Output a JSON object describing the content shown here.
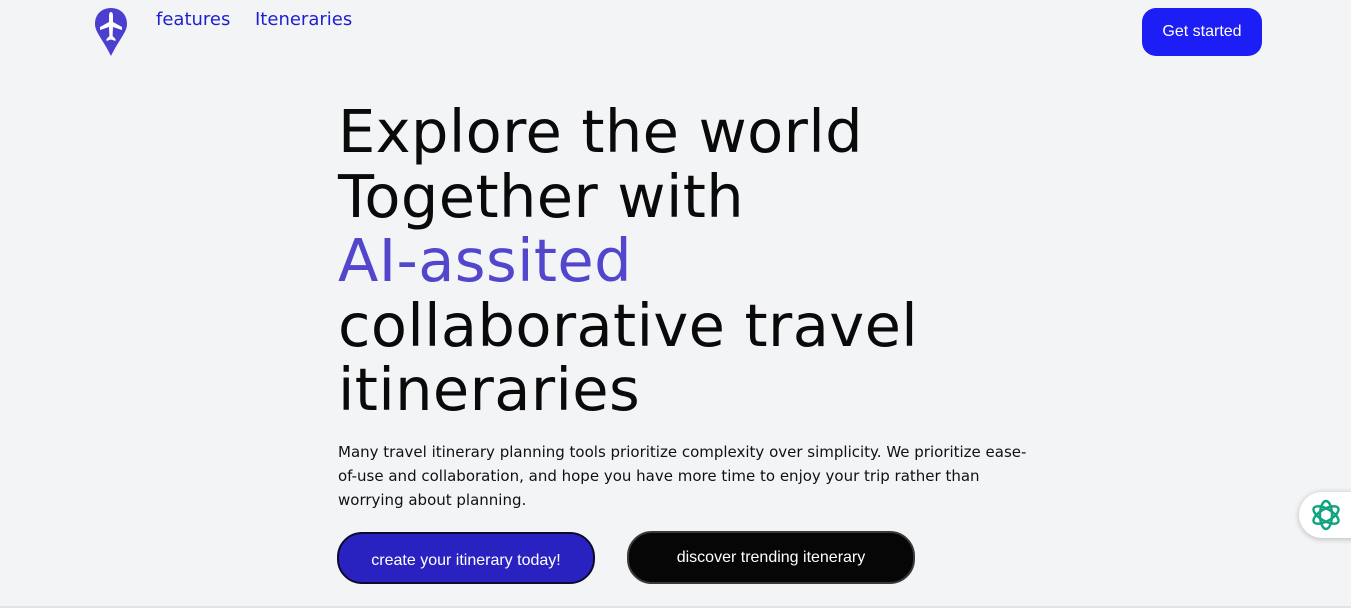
{
  "nav": {
    "logo_icon": "plane-pin-icon",
    "links": [
      "features",
      "Iteneraries"
    ],
    "cta_label": "Get started"
  },
  "hero": {
    "title_lines": [
      "Explore the world",
      "Together with",
      "AI-assited",
      "collaborative travel",
      "itineraries"
    ],
    "description": "Many travel itinerary planning tools prioritize complexity over simplicity. We prioritize ease-of-use and collaboration, and hope you have more time to enjoy your trip rather than worrying about planning.",
    "primary_button": "create your itinerary today!",
    "secondary_button": "discover trending itenerary"
  },
  "widget": {
    "icon": "assistant-knot-icon"
  },
  "colors": {
    "background": "#f3f4f6",
    "brand_blue": "#1d1df5",
    "nav_link": "#1f1fd0",
    "accent_purple": "#5146cc",
    "primary_button": "#2a22c0",
    "secondary_button": "#060606",
    "widget_icon": "#10a37f"
  }
}
